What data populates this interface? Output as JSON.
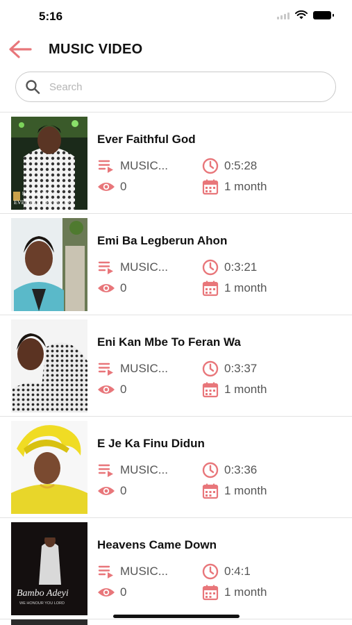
{
  "status_bar": {
    "time": "5:16"
  },
  "header": {
    "title": "MUSIC VIDEO"
  },
  "search": {
    "placeholder": "Search"
  },
  "videos": [
    {
      "title": "Ever Faithful God",
      "category": "MUSIC...",
      "duration": "0:5:28",
      "views": "0",
      "date": "1 month",
      "thumb_lines": [
        "BAMBO ADEYI",
        "EVER FAITHFUL GOD"
      ]
    },
    {
      "title": "Emi Ba Legberun Ahon",
      "category": "MUSIC...",
      "duration": "0:3:21",
      "views": "0",
      "date": "1 month"
    },
    {
      "title": "Eni Kan Mbe To Feran Wa",
      "category": "MUSIC...",
      "duration": "0:3:37",
      "views": "0",
      "date": "1 month"
    },
    {
      "title": "E Je Ka Finu Didun",
      "category": "MUSIC...",
      "duration": "0:3:36",
      "views": "0",
      "date": "1 month"
    },
    {
      "title": "Heavens Came Down",
      "category": "MUSIC...",
      "duration": "0:4:1",
      "views": "0",
      "date": "1 month",
      "thumb_lines": [
        "Bambo Adeyi",
        "WE HONOUR YOU LORD"
      ]
    }
  ],
  "colors": {
    "accent": "#e8767a",
    "text": "#111111",
    "meta": "#555555"
  },
  "icons": {
    "back": "arrow-left-icon",
    "search": "search-icon",
    "category": "playlist-icon",
    "views": "eye-icon",
    "duration": "clock-icon",
    "date": "calendar-icon"
  }
}
